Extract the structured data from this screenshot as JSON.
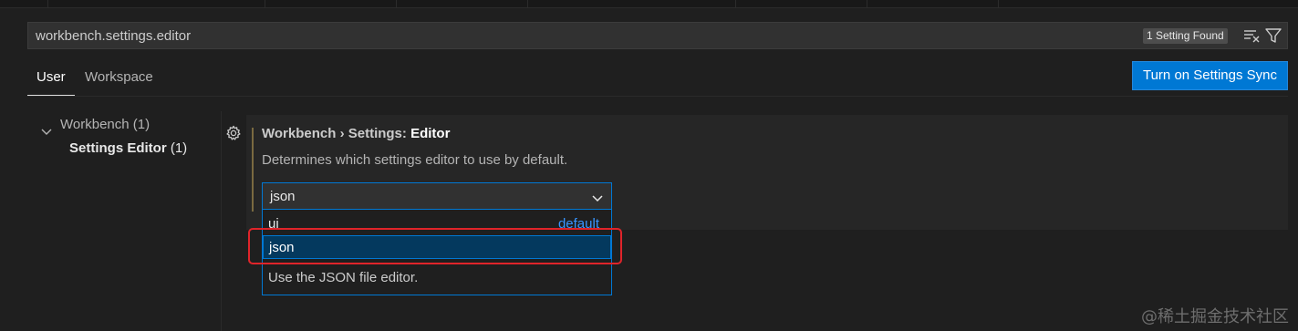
{
  "search": {
    "value": "workbench.settings.editor",
    "result_count": "1 Setting Found",
    "clear_icon": "clear-filter-icon",
    "filter_icon": "filter-icon"
  },
  "scope_tabs": [
    {
      "label": "User",
      "active": true
    },
    {
      "label": "Workspace",
      "active": false
    }
  ],
  "sync_button": {
    "label": "Turn on Settings Sync",
    "color": "#0078d4"
  },
  "tree": {
    "parent": {
      "label": "Workbench",
      "count": "(1)"
    },
    "child": {
      "label": "Settings Editor",
      "count": "(1)"
    }
  },
  "setting": {
    "breadcrumb": "Workbench › Settings: ",
    "name": "Editor",
    "description": "Determines which settings editor to use by default.",
    "selected_value": "json",
    "options": [
      {
        "label": "ui",
        "tag": "default"
      },
      {
        "label": "json"
      }
    ],
    "option_detail": "Use the JSON file editor."
  },
  "watermark": "@稀土掘金技术社区",
  "colors": {
    "accent": "#0078d4",
    "highlight_border": "#e0242a",
    "selected_option_bg": "#04395e"
  }
}
